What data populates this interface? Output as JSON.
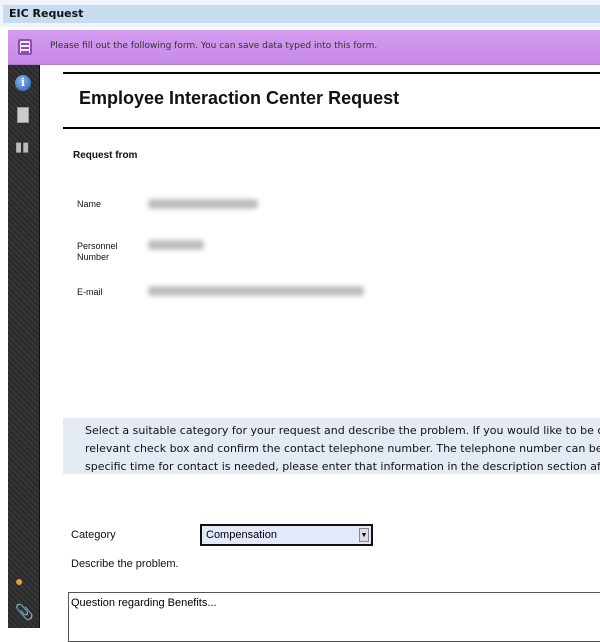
{
  "window": {
    "title": "EIC Request"
  },
  "infobar": {
    "message": "Please fill out the following form. You can save data typed into this form.",
    "icon": "form-icon"
  },
  "sidebar": {
    "icons": [
      "info-icon",
      "pages-icon",
      "binoculars-icon",
      "comments-icon",
      "attachment-icon"
    ]
  },
  "form": {
    "title": "Employee Interaction Center Request",
    "section": "Request from",
    "fields": {
      "name_label": "Name",
      "personnel_label": "Personnel Number",
      "email_label": "E-mail"
    },
    "instructions": [
      "Select a suitable category for your request and describe the problem.  If you would like to be called ba",
      "relevant check box and confirm the contact telephone number. The telephone number can be chang",
      "specific time for contact is needed, please enter that information in the description section after des"
    ],
    "category_label": "Category",
    "category_value": "Compensation",
    "describe_label": "Describe the problem.",
    "description_value": "Question regarding Benefits..."
  }
}
